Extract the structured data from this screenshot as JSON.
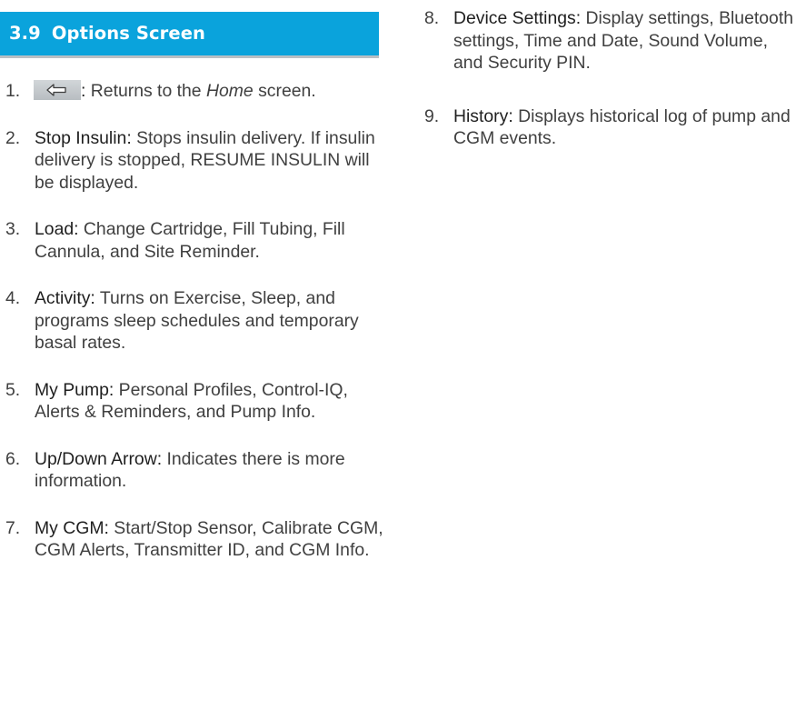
{
  "section": {
    "number": "3.9",
    "title": "Options Screen"
  },
  "icons": {
    "back_button": "back-arrow-icon"
  },
  "colors": {
    "header_bar": "#0aa3dc",
    "header_underline": "#b9bfc4",
    "body_text": "#404040"
  },
  "items": [
    {
      "num": "1.",
      "icon": "back-arrow-icon",
      "colon": ":",
      "text_before": " Returns to the ",
      "screen_name": "Home",
      "text_after": " screen."
    },
    {
      "num": "2.",
      "term": "Stop Insulin:",
      "text": " Stops insulin delivery. If insulin delivery is stopped, RESUME INSULIN will be displayed."
    },
    {
      "num": "3.",
      "term": "Load:",
      "text": " Change Cartridge, Fill Tubing, Fill Cannula, and Site Reminder."
    },
    {
      "num": "4.",
      "term": "Activity:",
      "text": " Turns on Exercise, Sleep, and programs sleep schedules and temporary basal rates."
    },
    {
      "num": "5.",
      "term": "My Pump:",
      "text": " Personal Profiles, Control-IQ, Alerts & Reminders, and Pump Info."
    },
    {
      "num": "6.",
      "term": "Up/Down Arrow:",
      "text": " Indicates there is more information."
    },
    {
      "num": "7.",
      "term": "My CGM:",
      "text": " Start/Stop Sensor, Calibrate CGM, CGM Alerts, Transmitter ID, and CGM Info."
    },
    {
      "num": "8.",
      "term": "Device Settings:",
      "text": " Display settings, Bluetooth settings, Time and Date, Sound Volume, and Security PIN."
    },
    {
      "num": "9.",
      "term": "History:",
      "text": " Displays historical log of pump and CGM events."
    }
  ]
}
